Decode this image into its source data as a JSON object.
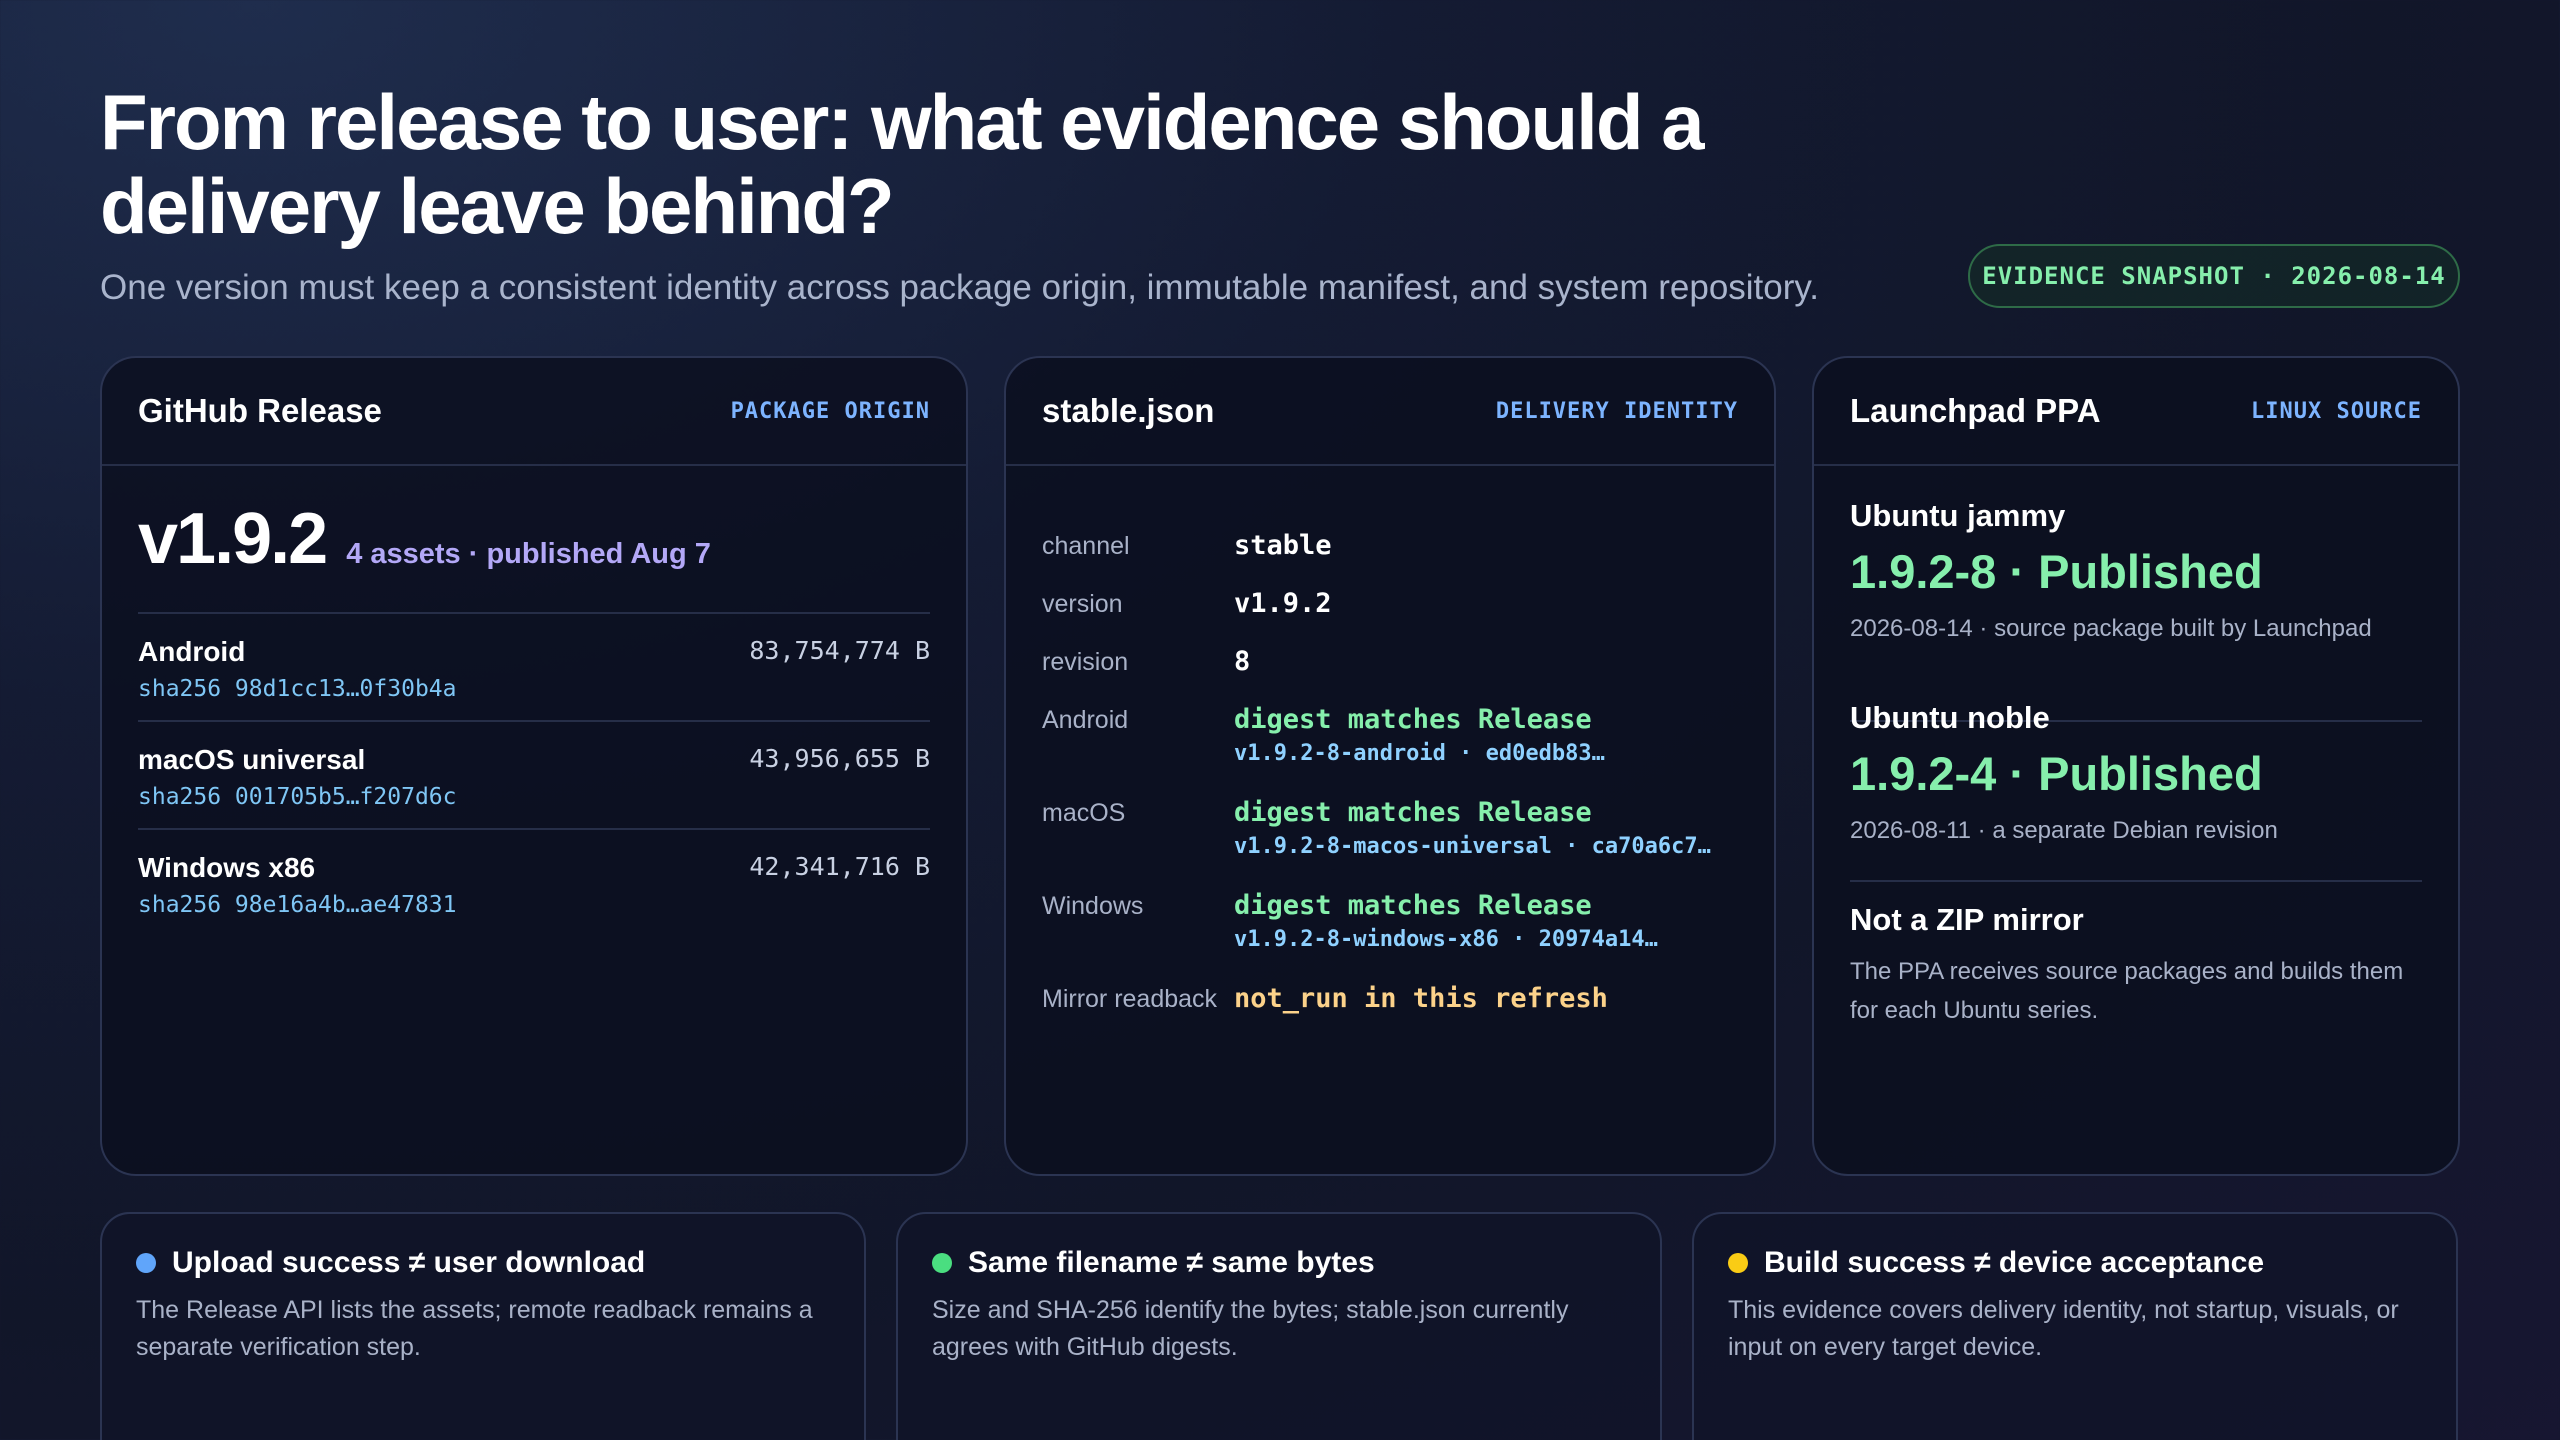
{
  "header": {
    "title": "From release to user: what evidence should a delivery leave behind?",
    "subtitle": "One version must keep a consistent identity across package origin, immutable manifest, and system repository.",
    "snapshot": "EVIDENCE SNAPSHOT · 2026-08-14"
  },
  "github": {
    "title": "GitHub Release",
    "tag": "PACKAGE ORIGIN",
    "version": "v1.9.2",
    "meta": "4 assets · published Aug 7",
    "assets": [
      {
        "name": "Android",
        "hash": "sha256 98d1cc13…0f30b4a",
        "size": "83,754,774 B"
      },
      {
        "name": "macOS universal",
        "hash": "sha256 001705b5…f207d6c",
        "size": "43,956,655 B"
      },
      {
        "name": "Windows x86",
        "hash": "sha256 98e16a4b…ae47831",
        "size": "42,341,716 B"
      }
    ]
  },
  "stable": {
    "title": "stable.json",
    "tag": "DELIVERY IDENTITY",
    "rows": {
      "channel": {
        "key": "channel",
        "value": "stable"
      },
      "version": {
        "key": "version",
        "value": "v1.9.2"
      },
      "revision": {
        "key": "revision",
        "value": "8"
      },
      "android": {
        "key": "Android",
        "value": "digest matches Release",
        "sub": "v1.9.2-8-android · ed0edb83…"
      },
      "macos": {
        "key": "macOS",
        "value": "digest matches Release",
        "sub": "v1.9.2-8-macos-universal · ca70a6c7…"
      },
      "windows": {
        "key": "Windows",
        "value": "digest matches Release",
        "sub": "v1.9.2-8-windows-x86 · 20974a14…"
      },
      "mirror": {
        "key": "Mirror readback",
        "value": "not_run in this refresh"
      }
    }
  },
  "ppa": {
    "title": "Launchpad PPA",
    "tag": "LINUX SOURCE",
    "series": [
      {
        "name": "Ubuntu jammy",
        "status": "1.9.2-8 · Published",
        "note": "2026-08-14 · source package built by Launchpad"
      },
      {
        "name": "Ubuntu noble",
        "status": "1.9.2-4 · Published",
        "note": "2026-08-11 · a separate Debian revision"
      }
    ],
    "zip": {
      "title": "Not a ZIP mirror",
      "body": "The PPA receives source packages and builds them for each Ubuntu series."
    }
  },
  "notes": [
    {
      "title": "Upload success ≠ user download",
      "body": "The Release API lists the assets; remote readback remains a separate verification step.",
      "color": "#60a5fa"
    },
    {
      "title": "Same filename ≠ same bytes",
      "body": "Size and SHA-256 identify the bytes; stable.json currently agrees with GitHub digests.",
      "color": "#4ade80"
    },
    {
      "title": "Build success ≠ device acceptance",
      "body": "This evidence covers delivery identity, not startup, visuals, or input on every target device.",
      "color": "#facc15"
    }
  ]
}
